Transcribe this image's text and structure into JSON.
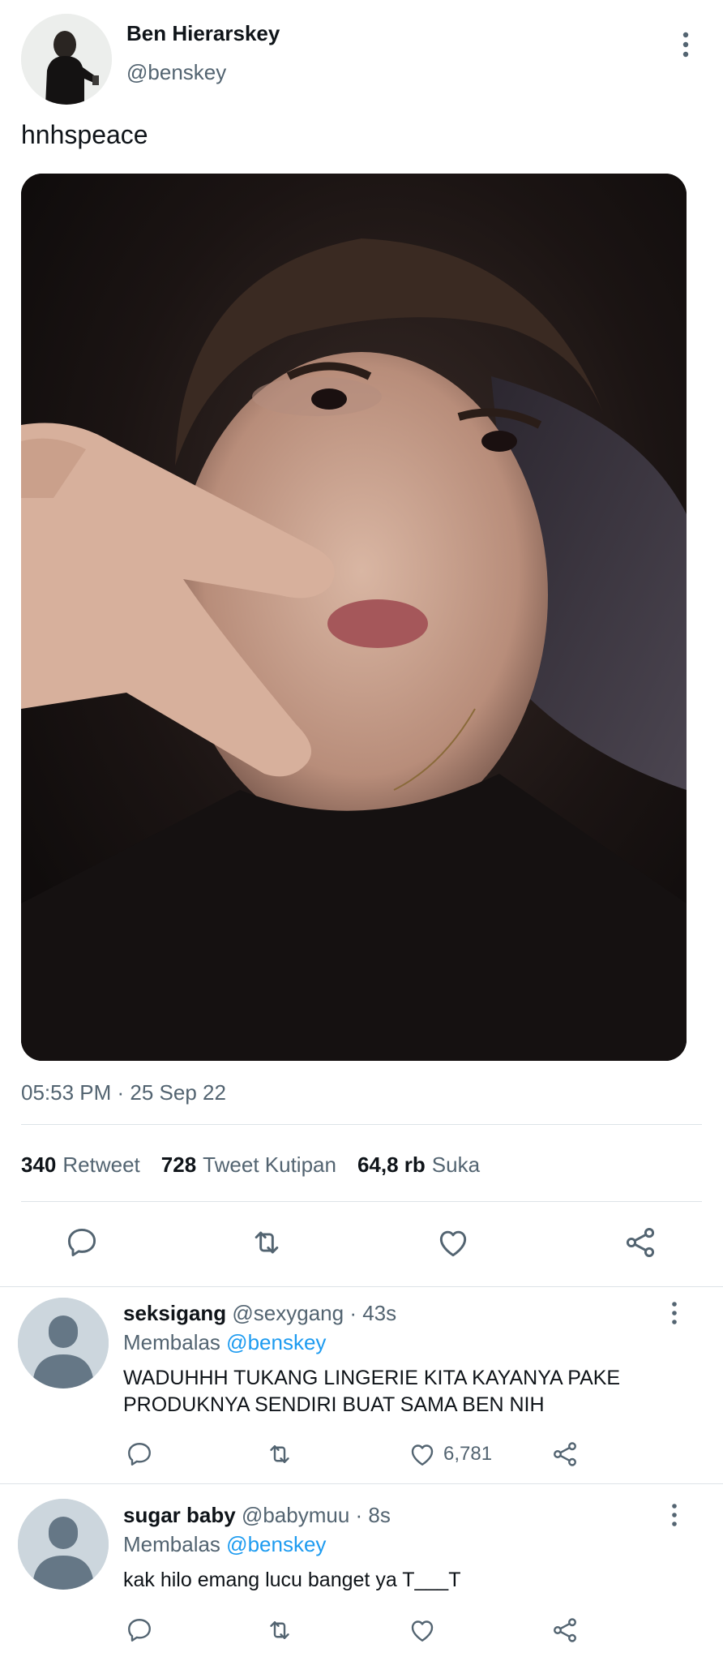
{
  "tweet": {
    "author": {
      "display_name": "Ben Hierarskey",
      "handle": "@benskey"
    },
    "text": "hnhspeace",
    "timestamp": "05:53 PM · 25 Sep 22",
    "stats": {
      "retweets_count": "340",
      "retweets_label": "Retweet",
      "quotes_count": "728",
      "quotes_label": "Tweet Kutipan",
      "likes_count": "64,8 rb",
      "likes_label": "Suka"
    }
  },
  "replies": [
    {
      "display_name": "seksigang",
      "handle": "@sexygang",
      "time": "· 43s",
      "replying_label": "Membalas",
      "replying_to": "@benskey",
      "text": "WADUHHH TUKANG LINGERIE KITA KAYANYA PAKE PRODUKNYA SENDIRI BUAT SAMA BEN NIH",
      "likes": "6,781"
    },
    {
      "display_name": "sugar baby",
      "handle": "@babymuu",
      "time": "· 8s",
      "replying_label": "Membalas",
      "replying_to": "@benskey",
      "text": "kak hilo emang lucu banget ya T___T",
      "likes": ""
    }
  ],
  "colors": {
    "text_primary": "#0f1419",
    "text_secondary": "#536471",
    "link": "#1d9bf0",
    "divider": "#dde3e7",
    "icon": "#536471",
    "default_avatar_bg": "#ccd6dd",
    "default_avatar_fg": "#657786"
  },
  "icons": {
    "reply": "speech-bubble-icon",
    "retweet": "retweet-icon",
    "like": "heart-icon",
    "share": "share-icon",
    "more": "vertical-dots-icon"
  }
}
